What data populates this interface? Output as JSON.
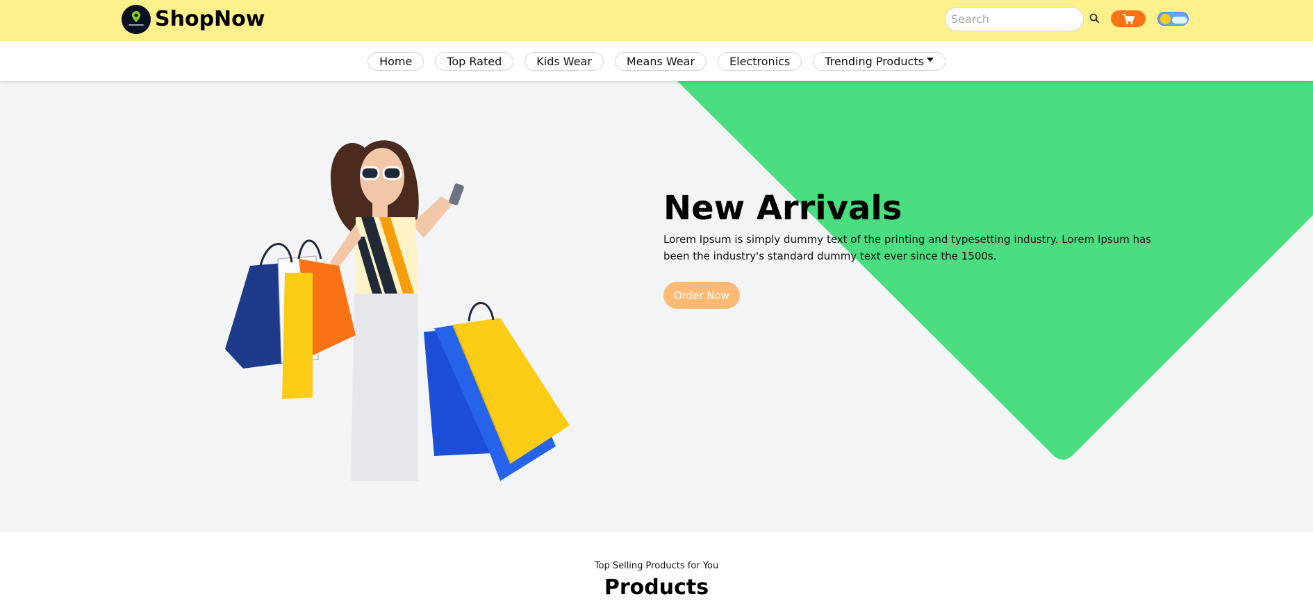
{
  "header": {
    "brand": "ShopNow",
    "search": {
      "placeholder": "Search",
      "value": ""
    },
    "icons": {
      "logo": "logo-icon",
      "search": "search-icon",
      "cart": "cart-icon",
      "theme": "theme-toggle-icon"
    }
  },
  "nav": {
    "items": [
      {
        "label": "Home"
      },
      {
        "label": "Top Rated"
      },
      {
        "label": "Kids Wear"
      },
      {
        "label": "Means Wear"
      },
      {
        "label": "Electronics"
      },
      {
        "label": "Trending Products",
        "has_dropdown": true
      }
    ]
  },
  "hero": {
    "title": "New Arrivals",
    "description": "Lorem Ipsum is simply dummy text of the printing and typesetting industry. Lorem Ipsum has been the industry's standard dummy text ever since the 1500s.",
    "button": "Order Now"
  },
  "products": {
    "subtitle": "Top Selling Products for You",
    "title": "Products"
  },
  "colors": {
    "topbar": "#fef08a",
    "accent_green": "#4ade80",
    "cart_button": "#f97316",
    "order_button": "#fdba74",
    "hero_bg": "#f3f4f6"
  }
}
